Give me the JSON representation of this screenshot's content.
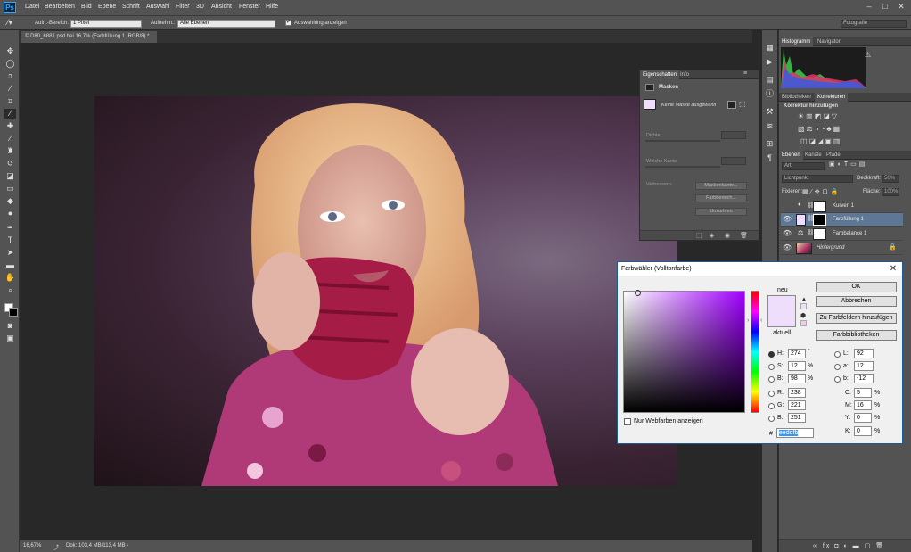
{
  "app": {
    "logo": "Ps"
  },
  "menu": [
    "Datei",
    "Bearbeiten",
    "Bild",
    "Ebene",
    "Schrift",
    "Auswahl",
    "Filter",
    "3D",
    "Ansicht",
    "Fenster",
    "Hilfe"
  ],
  "window_controls": {
    "minimize": "–",
    "maximize": "□",
    "close": "✕"
  },
  "options": {
    "sample_size_label": "Aufn.-Bereich:",
    "sample_size_value": "1 Pixel",
    "sample_label": "Aufnehm.:",
    "sample_value": "Alle Ebenen",
    "show_ring_label": "Auswahlring anzeigen",
    "workspace": "Fotografie"
  },
  "document": {
    "tab_title": "© D80_6881.psd bei 16,7% (Farbfüllung 1, RGB/8) *",
    "tab_close": "×",
    "zoom": "16,67%",
    "doc_info": "Dok: 103,4 MB/113,4 MB"
  },
  "histogram_panel": {
    "tabs": [
      "Histogramm",
      "Navigator"
    ],
    "warning": "⚠"
  },
  "adjust_panel": {
    "tabs": [
      "Bibliotheken",
      "Korrekturen"
    ],
    "heading": "Korrektur hinzufügen"
  },
  "layers_panel": {
    "tabs": [
      "Ebenen",
      "Kanäle",
      "Pfade"
    ],
    "filter_label": "Art",
    "blend_mode": "Lichtpunkt",
    "opacity_label": "Deckkraft:",
    "opacity_value": "50%",
    "lock_label": "Fixieren:",
    "fill_label": "Fläche:",
    "fill_value": "100%",
    "layers": [
      {
        "name": "Kurven 1",
        "visible": false,
        "selected": false
      },
      {
        "name": "Farbfüllung 1",
        "visible": true,
        "selected": true
      },
      {
        "name": "Farbbalance 1",
        "visible": true,
        "selected": false
      },
      {
        "name": "Hintergrund",
        "visible": true,
        "selected": false
      }
    ],
    "bottom_icons": "∞  fx  ◘  ◐  ▬  ▢  🗑"
  },
  "properties_panel": {
    "tabs": [
      "Eigenschaften",
      "Info"
    ],
    "heading": "Masken",
    "mask_status": "Keine Maske ausgewählt",
    "density_label": "Dichte:",
    "feather_label": "Weiche Kante:",
    "refine_label": "Verbessern:",
    "buttons": [
      "Maskenkante...",
      "Farbbereich...",
      "Umkehren"
    ]
  },
  "color_picker": {
    "title": "Farbwähler (Volltonfarbe)",
    "close": "✕",
    "new_label": "neu",
    "current_label": "aktuell",
    "new_color": "#eeddfb",
    "current_color": "#eeddfb",
    "buttons": {
      "ok": "OK",
      "cancel": "Abbrechen",
      "add_swatch": "Zu Farbfeldern hinzufügen",
      "libraries": "Farbbibliotheken"
    },
    "webcolors_label": "Nur Webfarben anzeigen",
    "hsb": {
      "H": "274",
      "S": "12",
      "B": "98",
      "H_unit": "°",
      "S_unit": "%",
      "B_unit": "%"
    },
    "rgb": {
      "R": "238",
      "G": "221",
      "B": "251"
    },
    "lab": {
      "L": "92",
      "a": "12",
      "b": "-12"
    },
    "cmyk": {
      "C": "5",
      "M": "16",
      "Y": "0",
      "K": "0",
      "unit": "%"
    },
    "hex_label": "#",
    "hex": "eeddfb"
  }
}
